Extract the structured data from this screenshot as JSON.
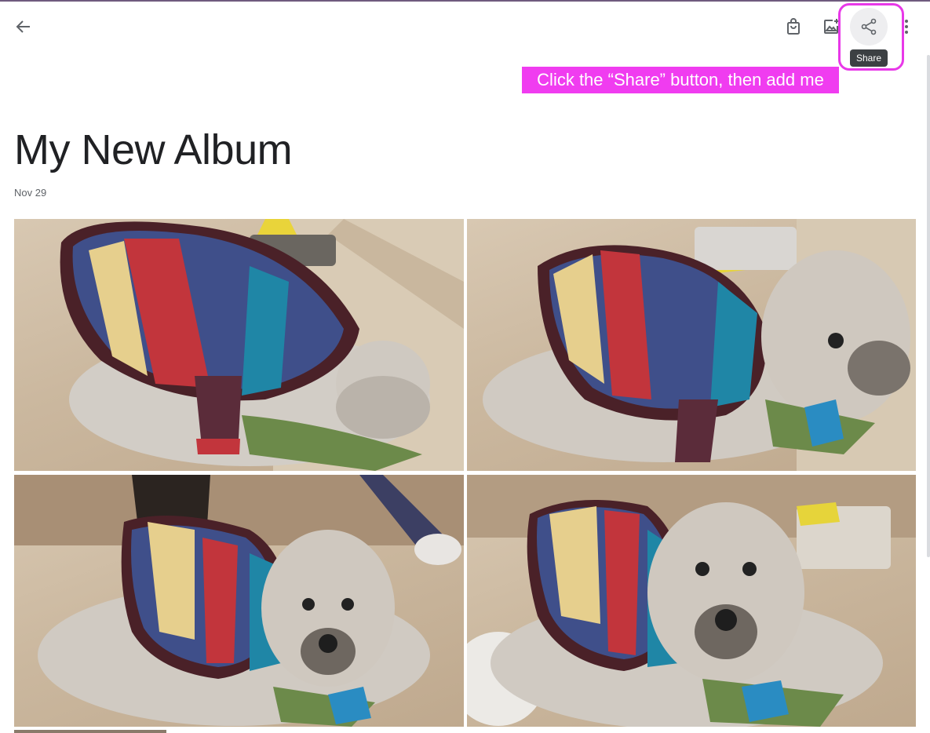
{
  "toolbar": {
    "back_icon": "arrow-back-icon",
    "shop_icon": "shopping-bag-icon",
    "add_photo_icon": "add-photo-icon",
    "share_icon": "share-icon",
    "more_icon": "more-vert-icon",
    "share_tooltip": "Share"
  },
  "callout": {
    "text": "Click the “Share” button, then add me"
  },
  "album": {
    "title": "My New Album",
    "date": "Nov 29"
  },
  "colors": {
    "accent_highlight": "#e838e8",
    "callout_bg": "#f03cf0",
    "tooltip_bg": "#3c4043"
  },
  "photos": [
    {
      "subject": "dog in striped sweater"
    },
    {
      "subject": "dog in striped sweater"
    },
    {
      "subject": "dog in striped sweater"
    },
    {
      "subject": "dog in striped sweater"
    }
  ]
}
